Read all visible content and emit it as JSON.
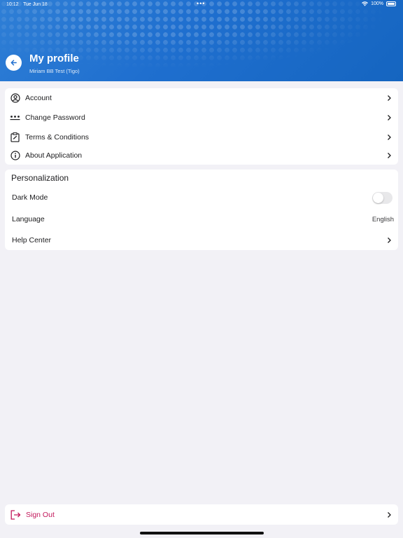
{
  "status_bar": {
    "time": "10:12",
    "date": "Tue Jun 18",
    "battery": "100%"
  },
  "header": {
    "title": "My profile",
    "subtitle": "Miriam BB Test (Tigo)"
  },
  "menu": {
    "items": [
      {
        "label": "Account",
        "icon": "user-circle-icon"
      },
      {
        "label": "Change Password",
        "icon": "password-dots-icon"
      },
      {
        "label": "Terms & Conditions",
        "icon": "clipboard-check-icon"
      },
      {
        "label": "About Application",
        "icon": "info-icon"
      }
    ]
  },
  "personalization": {
    "title": "Personalization",
    "dark_mode_label": "Dark Mode",
    "dark_mode_on": false,
    "language_label": "Language",
    "language_value": "English",
    "help_center_label": "Help Center"
  },
  "sign_out": {
    "label": "Sign Out",
    "icon": "sign-out-icon",
    "color": "#c2185b"
  },
  "colors": {
    "header_blue": "#1f6fcf",
    "background": "#f2f1f6"
  }
}
